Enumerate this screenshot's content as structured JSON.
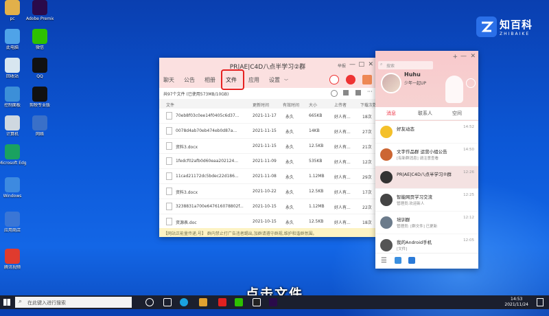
{
  "desktop_icons": [
    {
      "label": "pc",
      "color": "#e2b04a"
    },
    {
      "label": "Adobe Premiere",
      "color": "#2a0a4a"
    },
    {
      "label": "此电脑",
      "color": "#4fa3e8"
    },
    {
      "label": "微信",
      "color": "#2dc100"
    },
    {
      "label": "回收站",
      "color": "#d8e6f0"
    },
    {
      "label": "QQ",
      "color": "#111111"
    },
    {
      "label": "控制面板",
      "color": "#3c8fd8"
    },
    {
      "label": "剪映专业版",
      "color": "#111111"
    },
    {
      "label": "计算机",
      "color": "#cfd8e0"
    },
    {
      "label": "网络",
      "color": "#3a70c8"
    },
    {
      "label": "Microsoft Edge",
      "color": "#1aa260"
    },
    {
      "label": "Windows",
      "color": "#3d8ae0"
    },
    {
      "label": "应用商店",
      "color": "#3a76d6"
    },
    {
      "label": "腾讯视频",
      "color": "#e03b2e"
    }
  ],
  "logo": {
    "title": "知百科",
    "subtitle": "ZHIBAIKE"
  },
  "group_window": {
    "title": "PR|AE|C4D八点半学习②群",
    "more_label": "举报",
    "controls": [
      "—",
      "□",
      "✕"
    ],
    "tabs": [
      "聊天",
      "公告",
      "相册",
      "文件",
      "应用",
      "设置"
    ],
    "active_tab": "文件",
    "stats": "共97个文件 (已使用573MB/10GB)",
    "columns": [
      "文件",
      "更新时间",
      "有效时间",
      "大小",
      "上传者",
      "下载次数"
    ],
    "files": [
      {
        "name": "70eb8f03c0ee14f0405c6d37...",
        "time": "2021-11-17",
        "valid": "永久",
        "size": "665KB",
        "uploader": "好人有...",
        "downloads": "18次"
      },
      {
        "name": "0078d4ab70eb474eb0d87a...",
        "time": "2021-11-15",
        "valid": "永久",
        "size": "14KB",
        "uploader": "好人有...",
        "downloads": "27次"
      },
      {
        "name": "资料3.docx",
        "time": "2021-11-15",
        "valid": "永久",
        "size": "12.5KB",
        "uploader": "好人有...",
        "downloads": "21次"
      },
      {
        "name": "1fedcf02afb0d60eaa202124...",
        "time": "2021-11-09",
        "valid": "永久",
        "size": "535KB",
        "uploader": "好人有...",
        "downloads": "12次"
      },
      {
        "name": "11cad21172dc5bdec22d186...",
        "time": "2021-11-08",
        "valid": "永久",
        "size": "1.12MB",
        "uploader": "好人有...",
        "downloads": "29次"
      },
      {
        "name": "资料3.docx",
        "time": "2021-10-22",
        "valid": "永久",
        "size": "12.5KB",
        "uploader": "好人有...",
        "downloads": "17次"
      },
      {
        "name": "3238831a700e647616078802f...",
        "time": "2021-10-15",
        "valid": "永久",
        "size": "1.12MB",
        "uploader": "好人有...",
        "downloads": "22次"
      },
      {
        "name": "资源表.doc",
        "time": "2021-10-15",
        "valid": "永久",
        "size": "12.5KB",
        "uploader": "好人有...",
        "downloads": "18次"
      }
    ],
    "notice": "【网站正能量传递,号】 群内禁止打广告违者踢出,加群请遵守群规,维护和谐群氛围。"
  },
  "qq_panel": {
    "search_placeholder": "搜索",
    "nickname": "Huhu",
    "signature": "少年一起UP",
    "tabs": [
      "消息",
      "联系人",
      "空间"
    ],
    "active_tab": "消息",
    "items": [
      {
        "name": "好友动态",
        "sub": "",
        "time": "14:52",
        "color": "#f4c02a"
      },
      {
        "name": "文字作品群 运营小组公告",
        "sub": "[有新群消息] 请注意查看",
        "time": "14:50",
        "color": "#cc6633"
      },
      {
        "name": "PR|AE|C4D八点半学习②群",
        "sub": "",
        "time": "12:26",
        "color": "#333333"
      },
      {
        "name": "智能网页学习交流",
        "sub": "管理员:欢迎新人",
        "time": "12:25",
        "color": "#444444"
      },
      {
        "name": "培训群",
        "sub": "管理员: [群文件] 已更新",
        "time": "12:12",
        "color": "#6b7b8b"
      },
      {
        "name": "我的Android手机",
        "sub": "[文件]",
        "time": "12:05",
        "color": "#555555"
      }
    ]
  },
  "caption": "点击文件",
  "taskbar": {
    "search_placeholder": "在此键入进行搜索",
    "time": "14:53",
    "date": "2021/11/24"
  }
}
